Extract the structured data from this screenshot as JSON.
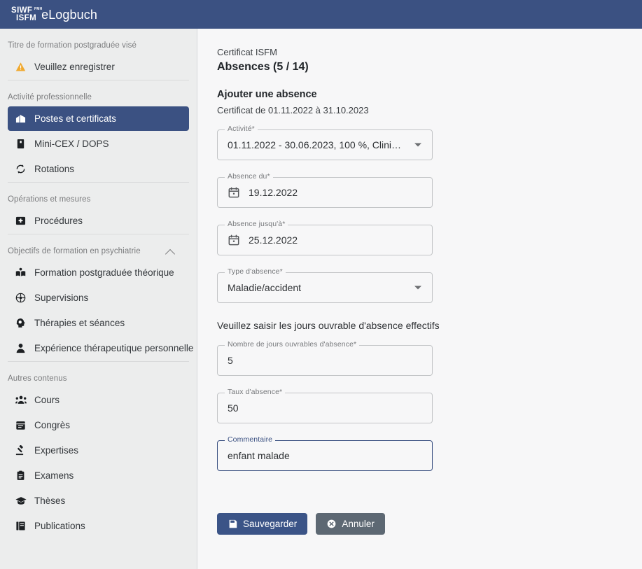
{
  "header": {
    "logo_line1": "SIWF",
    "logo_line2": "ISFM",
    "logo_sup": "FMH",
    "app_name": "eLogbuch",
    "bar_color": "#3b5182"
  },
  "sidebar": {
    "sections": [
      {
        "caption": "Titre de formation postgraduée visé",
        "collapsible": false,
        "items": [
          {
            "label": "Veuillez enregistrer",
            "icon": "warning-triangle-icon",
            "icon_color": "#f0a92e",
            "active": false
          }
        ]
      },
      {
        "caption": "Activité professionnelle",
        "collapsible": false,
        "items": [
          {
            "label": "Postes et certificats",
            "icon": "hospital-icon",
            "active": true
          },
          {
            "label": "Mini-CEX / DOPS",
            "icon": "bookmark-icon",
            "active": false
          },
          {
            "label": "Rotations",
            "icon": "rotate-icon",
            "active": false
          }
        ]
      },
      {
        "caption": "Opérations et mesures",
        "collapsible": false,
        "items": [
          {
            "label": "Procédures",
            "icon": "medical-cross-icon",
            "active": false
          }
        ]
      },
      {
        "caption": "Objectifs de formation en psychiatrie",
        "collapsible": true,
        "items": [
          {
            "label": "Formation postgraduée théorique",
            "icon": "book-reader-icon",
            "active": false
          },
          {
            "label": "Supervisions",
            "icon": "people-circle-icon",
            "active": false
          },
          {
            "label": "Thérapies et séances",
            "icon": "head-brain-icon",
            "active": false
          },
          {
            "label": "Expérience thérapeutique personnelle",
            "icon": "person-icon",
            "active": false
          }
        ]
      },
      {
        "caption": "Autres contenus",
        "collapsible": false,
        "items": [
          {
            "label": "Cours",
            "icon": "users-group-icon",
            "active": false
          },
          {
            "label": "Congrès",
            "icon": "calendar-icon",
            "active": false
          },
          {
            "label": "Expertises",
            "icon": "gavel-icon",
            "active": false
          },
          {
            "label": "Examens",
            "icon": "clipboard-icon",
            "active": false
          },
          {
            "label": "Thèses",
            "icon": "graduation-cap-icon",
            "active": false
          },
          {
            "label": "Publications",
            "icon": "book-open-icon",
            "active": false
          }
        ]
      }
    ],
    "active_item_color": "#3b5182"
  },
  "main": {
    "breadcrumb": "Certificat ISFM",
    "page_title": "Absences (5 / 14)",
    "section_title": "Ajouter une absence",
    "section_subtitle": "Certificat de 01.11.2022 à 31.10.2023",
    "hint": "Veuillez saisir les jours ouvrable d'absence effectifs",
    "fields": [
      {
        "name": "activite",
        "label": "Activité*",
        "value": "01.11.2022 - 30.06.2023, 100 %, Clini…",
        "type": "select",
        "focused": false
      },
      {
        "name": "absence_du",
        "label": "Absence du*",
        "value": "19.12.2022",
        "type": "date",
        "icon": "calendar-icon",
        "focused": false
      },
      {
        "name": "absence_jusqua",
        "label": "Absence jusqu'à*",
        "value": "25.12.2022",
        "type": "date",
        "icon": "calendar-icon",
        "focused": false
      },
      {
        "name": "type_absence",
        "label": "Type d'absence*",
        "value": "Maladie/accident",
        "type": "select",
        "focused": false
      },
      {
        "name": "nombre_jours",
        "label": "Nombre de jours ouvrables d'absence*",
        "value": "5",
        "type": "text",
        "focused": false
      },
      {
        "name": "taux_absence",
        "label": "Taux d'absence*",
        "value": "50",
        "type": "text",
        "focused": false
      },
      {
        "name": "commentaire",
        "label": "Commentaire",
        "value": "enfant malade",
        "type": "text",
        "focused": true
      }
    ],
    "buttons": {
      "save_label": "Sauvegarder",
      "save_icon": "save-floppy-icon",
      "save_color": "#3b5487",
      "cancel_label": "Annuler",
      "cancel_icon": "cancel-circle-icon",
      "cancel_color": "#5d6873"
    }
  }
}
